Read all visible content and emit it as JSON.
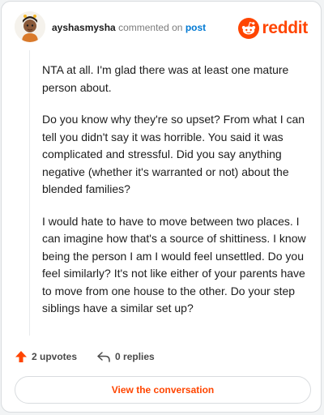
{
  "header": {
    "username": "ayshasmysha",
    "action_text": "commented on",
    "post_link": "post",
    "brand_name": "reddit"
  },
  "comment": {
    "paragraphs": [
      "NTA at all. I'm glad there was at least one mature person about.",
      "Do you know why they're so upset? From what I can tell you didn't say it was horrible. You said it was complicated and stressful. Did you say anything negative (whether it's warranted or not) about the blended families?",
      "I would hate to have to move between two places. I can imagine how that's a source of shittiness. I know being the person I am I would feel unsettled. Do you feel similarly? It's not like either of your parents have to move from one house to the other. Do your step siblings have a similar set up?"
    ]
  },
  "stats": {
    "upvotes": "2 upvotes",
    "replies": "0 replies"
  },
  "cta": {
    "label": "View the conversation"
  },
  "icons": {
    "upvote": "upvote-arrow-icon",
    "reply": "reply-arrow-icon",
    "brand": "reddit-snoo-icon",
    "avatar": "user-avatar"
  },
  "colors": {
    "brand_orange": "#ff4500",
    "link_blue": "#0079d3",
    "text": "#1c1c1c",
    "muted": "#7c7c7c",
    "border": "#d9dcdf"
  }
}
